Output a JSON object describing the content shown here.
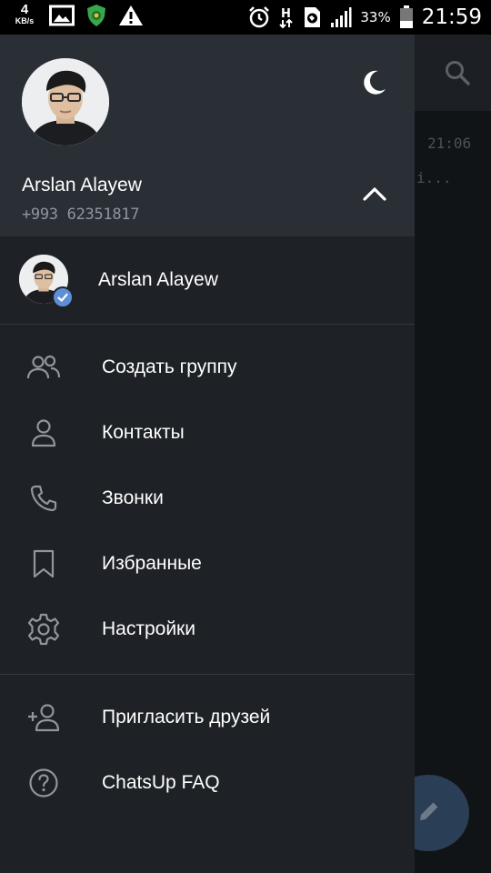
{
  "status_bar": {
    "speed_value": "4",
    "speed_unit": "KB/s",
    "battery_percent": "33%",
    "time": "21:59",
    "icons": [
      "gallery-icon",
      "shield-app-icon",
      "warning-icon",
      "alarm-icon",
      "h-plus-network-icon",
      "vpn-icon",
      "signal-icon",
      "battery-icon"
    ]
  },
  "background": {
    "chat_time": "21:06",
    "chat_snippet": "i...",
    "search_icon": "search-icon",
    "fab_icon": "pencil-icon"
  },
  "drawer": {
    "header": {
      "user_name": "Arslan Alayew",
      "phone": "+993 62351817",
      "theme_icon": "moon-icon",
      "toggle_icon": "chevron-up-icon"
    },
    "account": {
      "name": "Arslan Alayew",
      "badge_icon": "checkmark-icon"
    },
    "menu": [
      {
        "label": "Создать группу",
        "icon": "group-icon"
      },
      {
        "label": "Контакты",
        "icon": "person-icon"
      },
      {
        "label": "Звонки",
        "icon": "phone-icon"
      },
      {
        "label": "Избранные",
        "icon": "bookmark-icon"
      },
      {
        "label": "Настройки",
        "icon": "settings-icon"
      }
    ],
    "secondary_menu": [
      {
        "label": "Пригласить друзей",
        "icon": "add-person-icon"
      },
      {
        "label": "ChatsUp FAQ",
        "icon": "help-icon"
      }
    ]
  },
  "colors": {
    "drawer_bg": "#1e2126",
    "header_bg": "#2a2e35",
    "accent": "#5c8fd6",
    "icon_gray": "#8f969f"
  }
}
